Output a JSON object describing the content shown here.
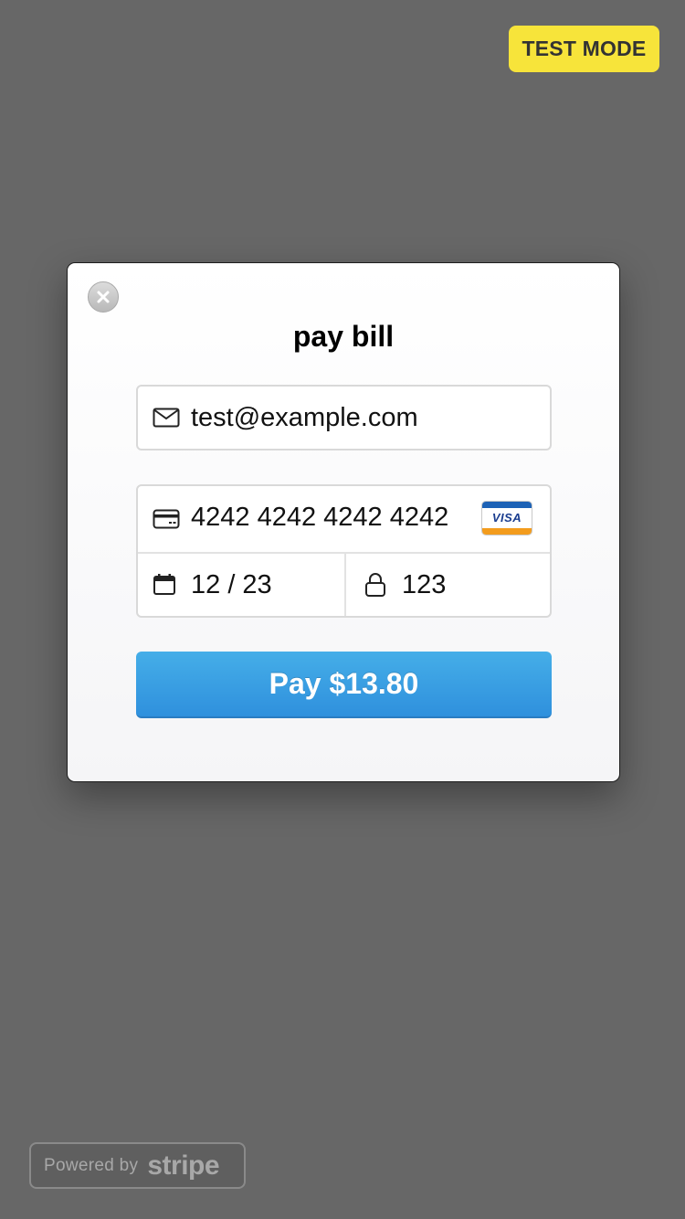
{
  "badge": {
    "test_mode": "TEST MODE"
  },
  "modal": {
    "title": "pay bill",
    "email": {
      "value": "test@example.com",
      "icon": "mail-icon"
    },
    "card": {
      "number": "4242 4242 4242 4242",
      "brand": "VISA",
      "icon": "credit-card-icon",
      "expiry": "12 / 23",
      "expiry_icon": "calendar-icon",
      "cvc": "123",
      "cvc_icon": "lock-icon"
    },
    "pay_button_label": "Pay $13.80"
  },
  "footer": {
    "powered_by": "Powered by",
    "brand": "stripe"
  },
  "colors": {
    "background": "#676767",
    "test_mode_badge": "#f7e43a",
    "pay_button": "#3a9fe3"
  }
}
